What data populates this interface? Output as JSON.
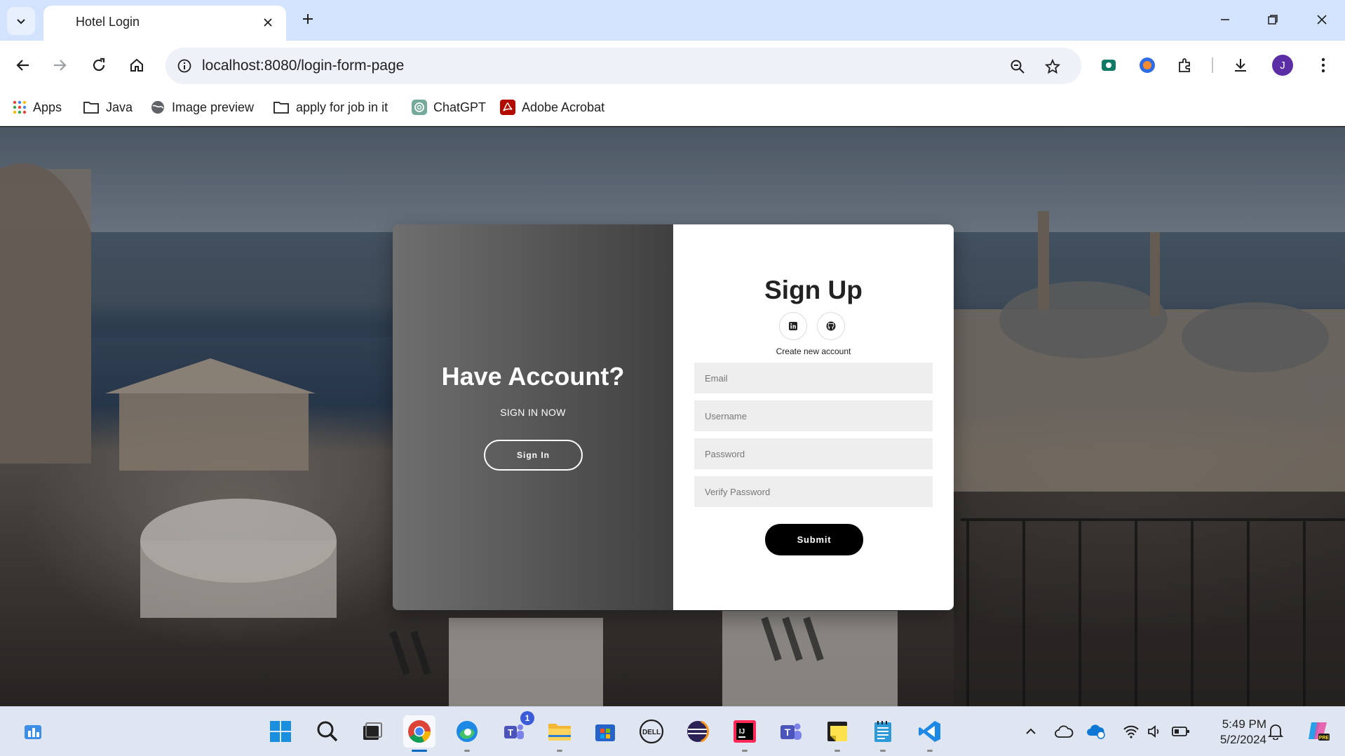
{
  "browser": {
    "tab": {
      "title": "Hotel Login"
    },
    "url": "localhost:8080/login-form-page",
    "profile_initial": "J",
    "bookmarks": [
      {
        "label": "Apps",
        "icon": "apps-grid-icon"
      },
      {
        "label": "Java",
        "icon": "folder-icon"
      },
      {
        "label": "Image preview",
        "icon": "globe-icon"
      },
      {
        "label": "apply for job in it",
        "icon": "folder-icon"
      },
      {
        "label": "ChatGPT",
        "icon": "chatgpt-icon"
      },
      {
        "label": "Adobe Acrobat",
        "icon": "acrobat-icon"
      }
    ]
  },
  "page": {
    "left_panel": {
      "heading": "Have Account?",
      "subheading": "SIGN IN NOW",
      "button": "Sign In"
    },
    "right_panel": {
      "heading": "Sign Up",
      "social": [
        "linkedin-icon",
        "github-icon"
      ],
      "caption": "Create new account",
      "fields": {
        "email": "Email",
        "username": "Username",
        "password": "Password",
        "verify_password": "Verify Password"
      },
      "submit": "Submit"
    }
  },
  "taskbar": {
    "apps": [
      "widgets-icon",
      "start-icon",
      "search-icon",
      "task-view-icon",
      "chrome-icon",
      "edge-icon",
      "teams-icon",
      "file-explorer-icon",
      "store-icon",
      "dell-icon",
      "eclipse-icon",
      "intellij-icon",
      "teams-work-icon",
      "sticky-notes-icon",
      "notepad-icon",
      "vscode-icon"
    ],
    "teams_badge": "1",
    "time": "5:49 PM",
    "date": "5/2/2024"
  },
  "colors": {
    "accent": "#0067c0",
    "tabstrip": "#d3e3fd",
    "submit": "#000000",
    "profile": "#5b2ea6"
  }
}
